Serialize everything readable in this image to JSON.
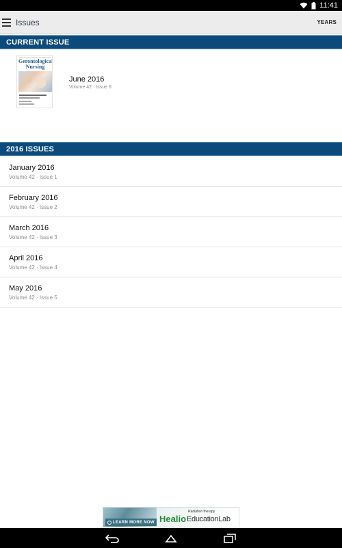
{
  "status_bar": {
    "time": "11:41",
    "icons": [
      "wifi-icon",
      "battery-icon"
    ]
  },
  "app_bar": {
    "title": "Issues",
    "menu_icon": "menu-icon",
    "years_label": "YEARS"
  },
  "current_issue": {
    "header": "CURRENT ISSUE",
    "cover_masthead": "Gerontological Nursing",
    "title": "June 2016",
    "meta": "Volume 42 · Issue 6"
  },
  "year_section": {
    "header": "2016 ISSUES",
    "items": [
      {
        "title": "January 2016",
        "meta": "Volume 42 · Issue 1"
      },
      {
        "title": "February 2016",
        "meta": "Volume 42 · Issue 2"
      },
      {
        "title": "March 2016",
        "meta": "Volume 42 · Issue 3"
      },
      {
        "title": "April 2016",
        "meta": "Volume 42 · Issue 4"
      },
      {
        "title": "May 2016",
        "meta": "Volume 42 · Issue 5"
      }
    ]
  },
  "ad": {
    "cta": "LEARN MORE NOW",
    "brand": "Healio",
    "sub": "Radiation therapy",
    "product": "EducationLab"
  },
  "colors": {
    "section_header": "#0d4a7c",
    "app_bar": "#ececec",
    "ad_green": "#2a8a3e"
  },
  "nav_bar": {
    "icons": [
      "back-icon",
      "home-icon",
      "recents-icon"
    ]
  }
}
